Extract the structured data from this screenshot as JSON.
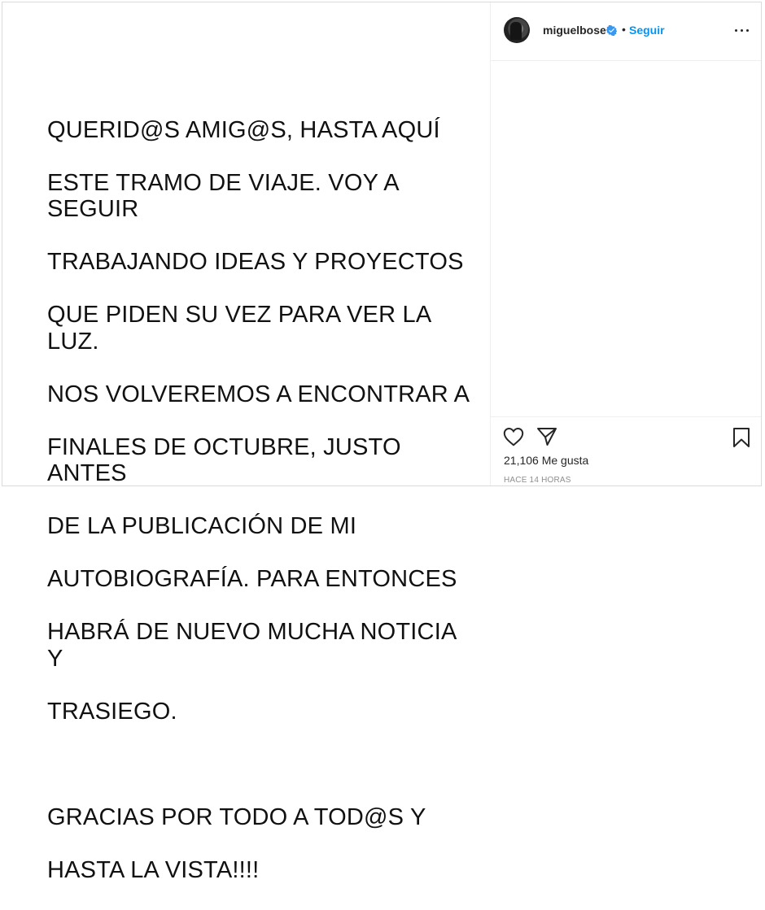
{
  "post": {
    "text_lines": [
      "QUERID@S AMIG@S, HASTA AQUÍ",
      "ESTE TRAMO DE VIAJE. VOY A SEGUIR",
      "TRABAJANDO IDEAS Y PROYECTOS",
      "QUE PIDEN SU VEZ PARA VER LA LUZ.",
      "NOS VOLVEREMOS A ENCONTRAR A",
      "FINALES DE OCTUBRE, JUSTO ANTES",
      "DE LA PUBLICACIÓN DE MI",
      "AUTOBIOGRAFÍA. PARA ENTONCES",
      "HABRÁ DE NUEVO MUCHA NOTICIA Y",
      "TRASIEGO.",
      "",
      "GRACIAS POR TODO A TOD@S Y",
      "HASTA LA VISTA!!!!"
    ]
  },
  "header": {
    "username": "miguelbose",
    "separator": "•",
    "follow_label": "Seguir",
    "verified_color": "#3897f0",
    "follow_color": "#0095f6"
  },
  "actions": {
    "like_icon": "heart-icon",
    "share_icon": "paper-plane-icon",
    "save_icon": "bookmark-icon",
    "likes_count": "21,106",
    "likes_label": "Me gusta",
    "timestamp": "HACE 14 HORAS"
  }
}
